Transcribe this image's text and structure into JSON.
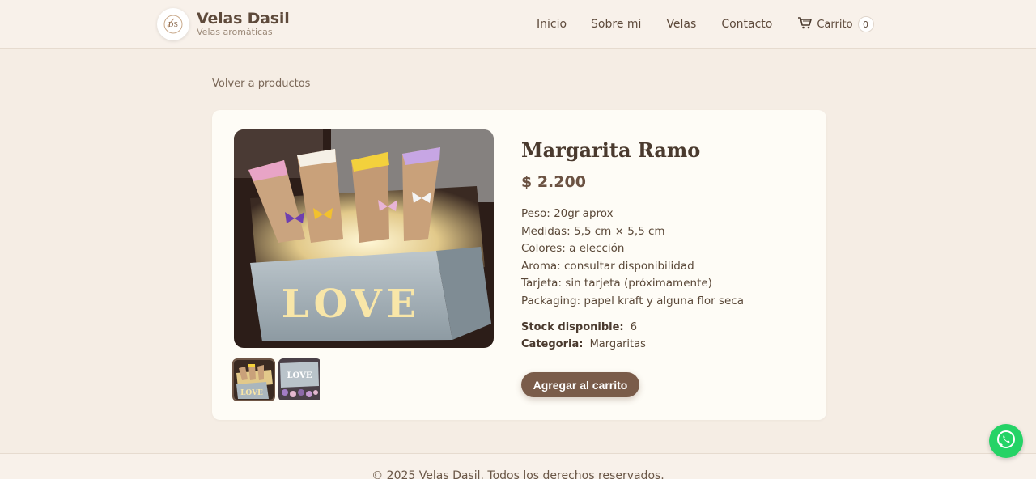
{
  "header": {
    "brand": "Velas Dasil",
    "tagline": "Velas aromáticas",
    "logo_initials": "DS",
    "nav": [
      "Inicio",
      "Sobre mi",
      "Velas",
      "Contacto"
    ],
    "cart_label": "Carrito",
    "cart_count": "0"
  },
  "back_link": "Volver a productos",
  "product": {
    "title": "Margarita Ramo",
    "price": "$ 2.200",
    "details": [
      "Peso: 20gr aprox",
      "Medidas: 5,5 cm × 5,5 cm",
      "Colores: a elección",
      "Aroma: consultar disponibilidad",
      "Tarjeta: sin tarjeta (próximamente)",
      "Packaging: papel kraft y alguna flor seca"
    ],
    "stock_label": "Stock disponible:",
    "stock_value": "6",
    "category_label": "Categoria:",
    "category_value": "Margaritas",
    "image_text": "LOVE",
    "add_button": "Agregar al carrito"
  },
  "footer": {
    "text": "© 2025 Velas Dasil. Todos los derechos reservados."
  },
  "colors": {
    "background": "#f5ede4",
    "card": "#fefcf6",
    "accent": "#7a5c4a",
    "whatsapp": "#25d366"
  },
  "icons": [
    "cart-icon",
    "whatsapp-icon",
    "logo-icon"
  ]
}
